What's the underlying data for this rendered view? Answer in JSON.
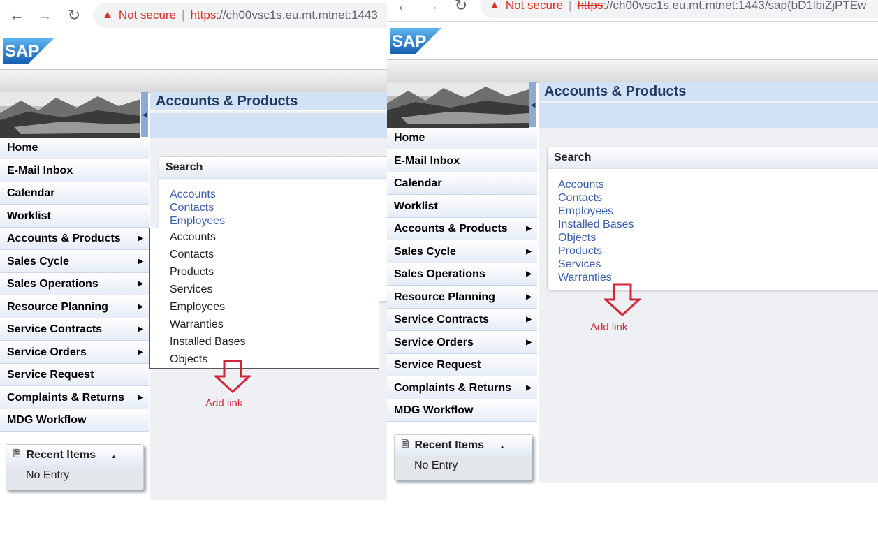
{
  "left": {
    "browser": {
      "warning": "Not secure",
      "separator": "|",
      "scheme": "https",
      "url_rest": "://ch00vsc1s.eu.mt.mtnet:1443"
    },
    "page_title": "Accounts & Products",
    "menu": [
      {
        "label": "Home",
        "submenu": false
      },
      {
        "label": "E-Mail Inbox",
        "submenu": false
      },
      {
        "label": "Calendar",
        "submenu": false
      },
      {
        "label": "Worklist",
        "submenu": false
      },
      {
        "label": "Accounts & Products",
        "submenu": true
      },
      {
        "label": "Sales Cycle",
        "submenu": true
      },
      {
        "label": "Sales Operations",
        "submenu": true
      },
      {
        "label": "Resource Planning",
        "submenu": true
      },
      {
        "label": "Service Contracts",
        "submenu": true
      },
      {
        "label": "Service Orders",
        "submenu": true
      },
      {
        "label": "Service Request",
        "submenu": false
      },
      {
        "label": "Complaints & Returns",
        "submenu": true
      },
      {
        "label": "MDG Workflow",
        "submenu": false
      }
    ],
    "recent": {
      "title": "Recent Items",
      "empty": "No Entry"
    },
    "search": {
      "title": "Search",
      "links": [
        "Accounts",
        "Contacts",
        "Employees"
      ]
    },
    "dropdown": [
      "Accounts",
      "Contacts",
      "Products",
      "Services",
      "Employees",
      "Warranties",
      "Installed Bases",
      "Objects"
    ],
    "annotation": "Add link"
  },
  "right": {
    "browser": {
      "warning": "Not secure",
      "separator": "|",
      "scheme": "https",
      "url_rest": "://ch00vsc1s.eu.mt.mtnet:1443/sap(bD1lbiZjPTEw"
    },
    "page_title": "Accounts & Products",
    "menu": [
      {
        "label": "Home",
        "submenu": false
      },
      {
        "label": "E-Mail Inbox",
        "submenu": false
      },
      {
        "label": "Calendar",
        "submenu": false
      },
      {
        "label": "Worklist",
        "submenu": false
      },
      {
        "label": "Accounts & Products",
        "submenu": true
      },
      {
        "label": "Sales Cycle",
        "submenu": true
      },
      {
        "label": "Sales Operations",
        "submenu": true
      },
      {
        "label": "Resource Planning",
        "submenu": true
      },
      {
        "label": "Service Contracts",
        "submenu": true
      },
      {
        "label": "Service Orders",
        "submenu": true
      },
      {
        "label": "Service Request",
        "submenu": false
      },
      {
        "label": "Complaints & Returns",
        "submenu": true
      },
      {
        "label": "MDG Workflow",
        "submenu": false
      }
    ],
    "recent": {
      "title": "Recent Items",
      "empty": "No Entry"
    },
    "search": {
      "title": "Search",
      "links": [
        "Accounts",
        "Contacts",
        "Employees",
        "Installed Bases",
        "Objects",
        "Products",
        "Services",
        "Warranties"
      ]
    },
    "annotation": "Add link"
  },
  "colors": {
    "link": "#3a5fab",
    "annotation": "#d0263a",
    "header_blue": "#d3e1f4",
    "sap_blue": "#1a75c9"
  },
  "icons": {
    "back": "back-arrow-icon",
    "forward": "forward-arrow-icon",
    "reload": "reload-icon",
    "warning": "warning-triangle-icon",
    "submenu": "submenu-arrow-icon"
  }
}
